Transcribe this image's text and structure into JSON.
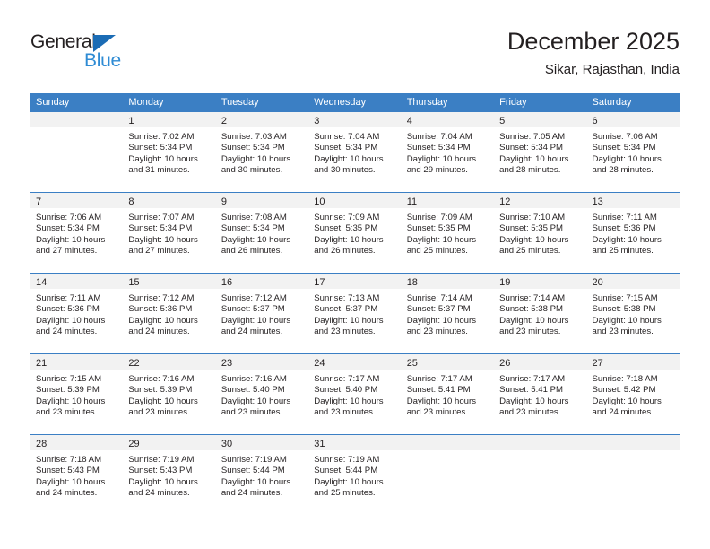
{
  "brand": {
    "name_part1": "General",
    "name_part2": "Blue",
    "logo_icon": "triangle-icon",
    "accent_color": "#2e8bd4",
    "dark_color": "#231f20"
  },
  "header": {
    "title": "December 2025",
    "subtitle": "Sikar, Rajasthan, India"
  },
  "calendar": {
    "header_bg": "#3b7fc4",
    "daynum_bg": "#f2f2f2",
    "weekdays": [
      "Sunday",
      "Monday",
      "Tuesday",
      "Wednesday",
      "Thursday",
      "Friday",
      "Saturday"
    ],
    "weeks": [
      [
        {
          "day": "",
          "lines": []
        },
        {
          "day": "1",
          "lines": [
            "Sunrise: 7:02 AM",
            "Sunset: 5:34 PM",
            "Daylight: 10 hours",
            "and 31 minutes."
          ]
        },
        {
          "day": "2",
          "lines": [
            "Sunrise: 7:03 AM",
            "Sunset: 5:34 PM",
            "Daylight: 10 hours",
            "and 30 minutes."
          ]
        },
        {
          "day": "3",
          "lines": [
            "Sunrise: 7:04 AM",
            "Sunset: 5:34 PM",
            "Daylight: 10 hours",
            "and 30 minutes."
          ]
        },
        {
          "day": "4",
          "lines": [
            "Sunrise: 7:04 AM",
            "Sunset: 5:34 PM",
            "Daylight: 10 hours",
            "and 29 minutes."
          ]
        },
        {
          "day": "5",
          "lines": [
            "Sunrise: 7:05 AM",
            "Sunset: 5:34 PM",
            "Daylight: 10 hours",
            "and 28 minutes."
          ]
        },
        {
          "day": "6",
          "lines": [
            "Sunrise: 7:06 AM",
            "Sunset: 5:34 PM",
            "Daylight: 10 hours",
            "and 28 minutes."
          ]
        }
      ],
      [
        {
          "day": "7",
          "lines": [
            "Sunrise: 7:06 AM",
            "Sunset: 5:34 PM",
            "Daylight: 10 hours",
            "and 27 minutes."
          ]
        },
        {
          "day": "8",
          "lines": [
            "Sunrise: 7:07 AM",
            "Sunset: 5:34 PM",
            "Daylight: 10 hours",
            "and 27 minutes."
          ]
        },
        {
          "day": "9",
          "lines": [
            "Sunrise: 7:08 AM",
            "Sunset: 5:34 PM",
            "Daylight: 10 hours",
            "and 26 minutes."
          ]
        },
        {
          "day": "10",
          "lines": [
            "Sunrise: 7:09 AM",
            "Sunset: 5:35 PM",
            "Daylight: 10 hours",
            "and 26 minutes."
          ]
        },
        {
          "day": "11",
          "lines": [
            "Sunrise: 7:09 AM",
            "Sunset: 5:35 PM",
            "Daylight: 10 hours",
            "and 25 minutes."
          ]
        },
        {
          "day": "12",
          "lines": [
            "Sunrise: 7:10 AM",
            "Sunset: 5:35 PM",
            "Daylight: 10 hours",
            "and 25 minutes."
          ]
        },
        {
          "day": "13",
          "lines": [
            "Sunrise: 7:11 AM",
            "Sunset: 5:36 PM",
            "Daylight: 10 hours",
            "and 25 minutes."
          ]
        }
      ],
      [
        {
          "day": "14",
          "lines": [
            "Sunrise: 7:11 AM",
            "Sunset: 5:36 PM",
            "Daylight: 10 hours",
            "and 24 minutes."
          ]
        },
        {
          "day": "15",
          "lines": [
            "Sunrise: 7:12 AM",
            "Sunset: 5:36 PM",
            "Daylight: 10 hours",
            "and 24 minutes."
          ]
        },
        {
          "day": "16",
          "lines": [
            "Sunrise: 7:12 AM",
            "Sunset: 5:37 PM",
            "Daylight: 10 hours",
            "and 24 minutes."
          ]
        },
        {
          "day": "17",
          "lines": [
            "Sunrise: 7:13 AM",
            "Sunset: 5:37 PM",
            "Daylight: 10 hours",
            "and 23 minutes."
          ]
        },
        {
          "day": "18",
          "lines": [
            "Sunrise: 7:14 AM",
            "Sunset: 5:37 PM",
            "Daylight: 10 hours",
            "and 23 minutes."
          ]
        },
        {
          "day": "19",
          "lines": [
            "Sunrise: 7:14 AM",
            "Sunset: 5:38 PM",
            "Daylight: 10 hours",
            "and 23 minutes."
          ]
        },
        {
          "day": "20",
          "lines": [
            "Sunrise: 7:15 AM",
            "Sunset: 5:38 PM",
            "Daylight: 10 hours",
            "and 23 minutes."
          ]
        }
      ],
      [
        {
          "day": "21",
          "lines": [
            "Sunrise: 7:15 AM",
            "Sunset: 5:39 PM",
            "Daylight: 10 hours",
            "and 23 minutes."
          ]
        },
        {
          "day": "22",
          "lines": [
            "Sunrise: 7:16 AM",
            "Sunset: 5:39 PM",
            "Daylight: 10 hours",
            "and 23 minutes."
          ]
        },
        {
          "day": "23",
          "lines": [
            "Sunrise: 7:16 AM",
            "Sunset: 5:40 PM",
            "Daylight: 10 hours",
            "and 23 minutes."
          ]
        },
        {
          "day": "24",
          "lines": [
            "Sunrise: 7:17 AM",
            "Sunset: 5:40 PM",
            "Daylight: 10 hours",
            "and 23 minutes."
          ]
        },
        {
          "day": "25",
          "lines": [
            "Sunrise: 7:17 AM",
            "Sunset: 5:41 PM",
            "Daylight: 10 hours",
            "and 23 minutes."
          ]
        },
        {
          "day": "26",
          "lines": [
            "Sunrise: 7:17 AM",
            "Sunset: 5:41 PM",
            "Daylight: 10 hours",
            "and 23 minutes."
          ]
        },
        {
          "day": "27",
          "lines": [
            "Sunrise: 7:18 AM",
            "Sunset: 5:42 PM",
            "Daylight: 10 hours",
            "and 24 minutes."
          ]
        }
      ],
      [
        {
          "day": "28",
          "lines": [
            "Sunrise: 7:18 AM",
            "Sunset: 5:43 PM",
            "Daylight: 10 hours",
            "and 24 minutes."
          ]
        },
        {
          "day": "29",
          "lines": [
            "Sunrise: 7:19 AM",
            "Sunset: 5:43 PM",
            "Daylight: 10 hours",
            "and 24 minutes."
          ]
        },
        {
          "day": "30",
          "lines": [
            "Sunrise: 7:19 AM",
            "Sunset: 5:44 PM",
            "Daylight: 10 hours",
            "and 24 minutes."
          ]
        },
        {
          "day": "31",
          "lines": [
            "Sunrise: 7:19 AM",
            "Sunset: 5:44 PM",
            "Daylight: 10 hours",
            "and 25 minutes."
          ]
        },
        {
          "day": "",
          "lines": []
        },
        {
          "day": "",
          "lines": []
        },
        {
          "day": "",
          "lines": []
        }
      ]
    ]
  }
}
